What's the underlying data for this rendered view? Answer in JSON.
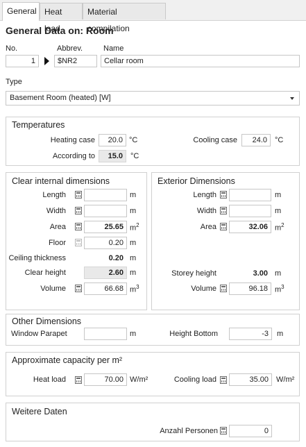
{
  "tabs": [
    "General",
    "Heat load",
    "Material compilation"
  ],
  "title": "General Data on: Room",
  "header": {
    "no_label": "No.",
    "no_value": "1",
    "abbrev_label": "Abbrev.",
    "abbrev_value": "$NR2",
    "name_label": "Name",
    "name_value": "Cellar room"
  },
  "type": {
    "label": "Type",
    "value": "Basement Room (heated) [W]"
  },
  "temperatures": {
    "title": "Temperatures",
    "heating_label": "Heating case",
    "heating_value": "20.0",
    "heating_unit": "°C",
    "according_label": "According to",
    "according_value": "15.0",
    "according_unit": "°C",
    "cooling_label": "Cooling case",
    "cooling_value": "24.0",
    "cooling_unit": "°C"
  },
  "clear_internal": {
    "title": "Clear internal dimensions",
    "length_label": "Length",
    "length_value": "",
    "length_unit": "m",
    "width_label": "Width",
    "width_value": "",
    "width_unit": "m",
    "area_label": "Area",
    "area_value": "25.65",
    "area_unit": "m",
    "floor_label": "Floor",
    "floor_value": "0.20",
    "floor_unit": "m",
    "ceiling_label": "Ceiling thickness",
    "ceiling_value": "0.20",
    "ceiling_unit": "m",
    "clear_height_label": "Clear height",
    "clear_height_value": "2.60",
    "clear_height_unit": "m",
    "volume_label": "Volume",
    "volume_value": "66.68",
    "volume_unit": "m"
  },
  "exterior": {
    "title": "Exterior Dimensions",
    "length_label": "Length",
    "length_value": "",
    "length_unit": "m",
    "width_label": "Width",
    "width_value": "",
    "width_unit": "m",
    "area_label": "Area",
    "area_value": "32.06",
    "area_unit": "m",
    "storey_label": "Storey height",
    "storey_value": "3.00",
    "storey_unit": "m",
    "volume_label": "Volume",
    "volume_value": "96.18",
    "volume_unit": "m"
  },
  "other": {
    "title": "Other Dimensions",
    "parapet_label": "Window Parapet",
    "parapet_value": "",
    "parapet_unit": "m",
    "height_bottom_label": "Height Bottom",
    "height_bottom_value": "-3",
    "height_bottom_unit": "m"
  },
  "capacity": {
    "title": "Approximate capacity per m²",
    "heat_label": "Heat load",
    "heat_value": "70.00",
    "heat_unit": "W/m²",
    "cool_label": "Cooling load",
    "cool_value": "35.00",
    "cool_unit": "W/m²"
  },
  "weitere": {
    "title": "Weitere Daten",
    "persons_label": "Anzahl Personen",
    "persons_value": "0"
  }
}
